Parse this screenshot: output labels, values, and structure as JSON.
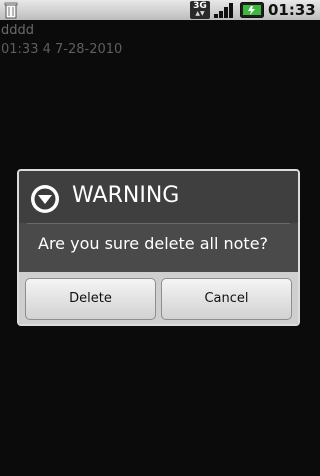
{
  "status_bar": {
    "network_label": "3G",
    "time": "01:33",
    "icons": [
      "trash-icon",
      "signal-icon",
      "battery-icon"
    ]
  },
  "note": {
    "title": "dddd",
    "meta": "01:33 4 7-28-2010"
  },
  "dialog": {
    "title": "WARNING",
    "message": "Are you sure delete all note?",
    "icon": "warning-icon",
    "buttons": {
      "delete": "Delete",
      "cancel": "Cancel"
    }
  },
  "colors": {
    "background": "#0b0b0b",
    "dialog_body": "#4a4a4a",
    "dialog_header": "#3f3f3f",
    "button_bar": "#cfcfcf"
  }
}
